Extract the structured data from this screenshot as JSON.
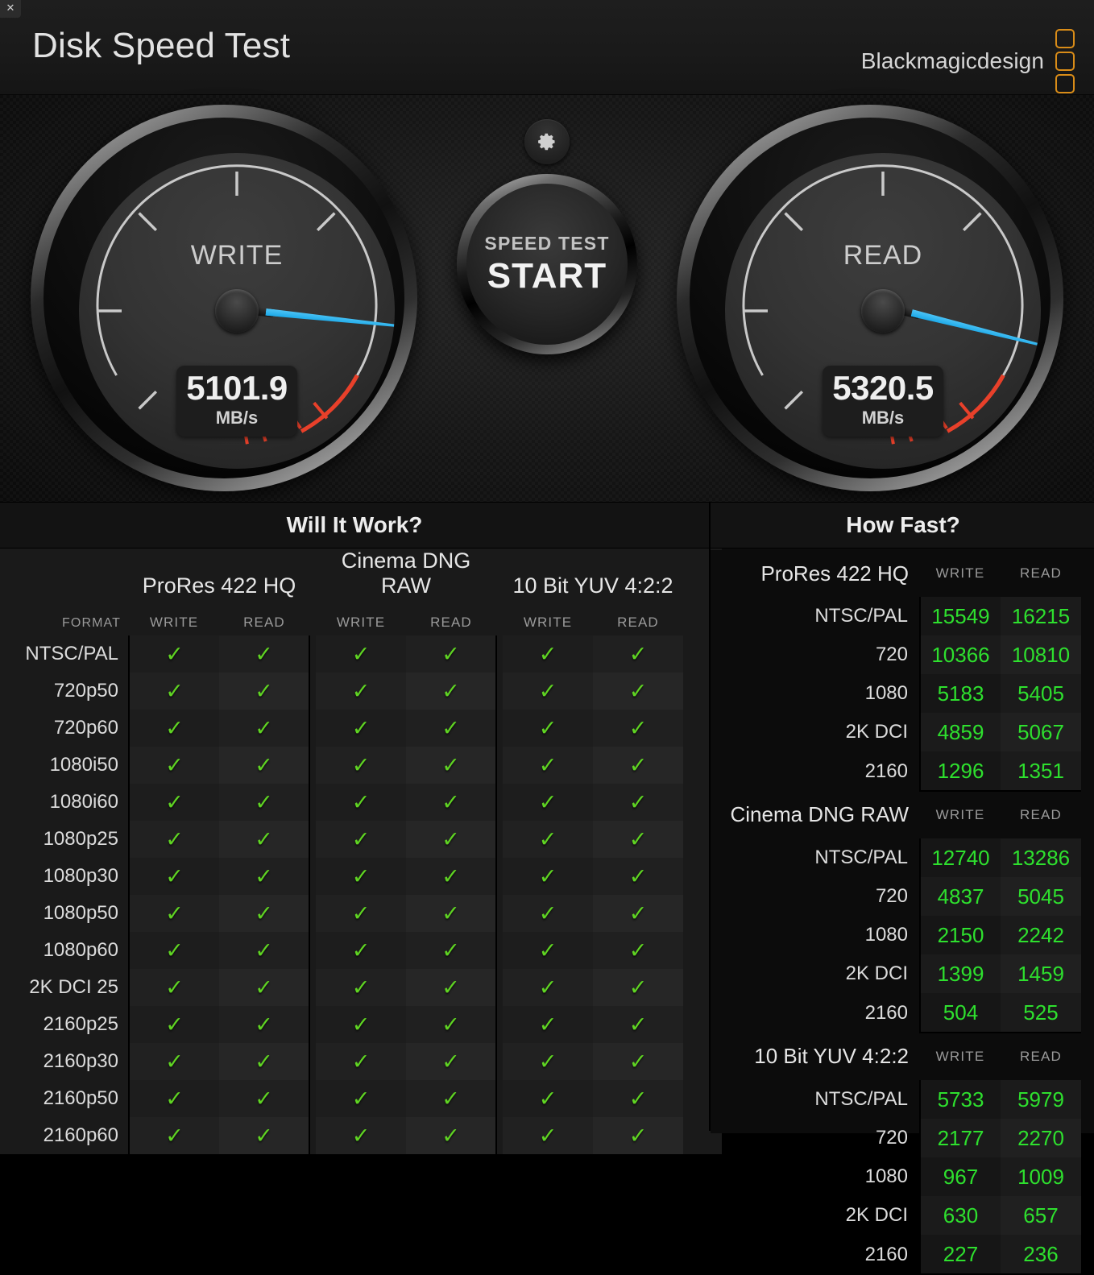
{
  "window": {
    "close_label": "✕"
  },
  "header": {
    "title": "Disk Speed Test",
    "brand": "Blackmagicdesign"
  },
  "gauges": {
    "write": {
      "label": "WRITE",
      "value": "5101.9",
      "unit": "MB/s"
    },
    "read": {
      "label": "READ",
      "value": "5320.5",
      "unit": "MB/s"
    }
  },
  "controls": {
    "gear_icon": "gear-icon",
    "start_line1": "SPEED TEST",
    "start_line2": "START"
  },
  "will_it_work": {
    "title": "Will It Work?",
    "format_header": "FORMAT",
    "groups": [
      "ProRes 422 HQ",
      "Cinema DNG RAW",
      "10 Bit YUV 4:2:2"
    ],
    "sub_headers": [
      "WRITE",
      "READ"
    ],
    "check_glyph": "✓",
    "rows": [
      {
        "format": "NTSC/PAL",
        "cells": [
          true,
          true,
          true,
          true,
          true,
          true
        ]
      },
      {
        "format": "720p50",
        "cells": [
          true,
          true,
          true,
          true,
          true,
          true
        ]
      },
      {
        "format": "720p60",
        "cells": [
          true,
          true,
          true,
          true,
          true,
          true
        ]
      },
      {
        "format": "1080i50",
        "cells": [
          true,
          true,
          true,
          true,
          true,
          true
        ]
      },
      {
        "format": "1080i60",
        "cells": [
          true,
          true,
          true,
          true,
          true,
          true
        ]
      },
      {
        "format": "1080p25",
        "cells": [
          true,
          true,
          true,
          true,
          true,
          true
        ]
      },
      {
        "format": "1080p30",
        "cells": [
          true,
          true,
          true,
          true,
          true,
          true
        ]
      },
      {
        "format": "1080p50",
        "cells": [
          true,
          true,
          true,
          true,
          true,
          true
        ]
      },
      {
        "format": "1080p60",
        "cells": [
          true,
          true,
          true,
          true,
          true,
          true
        ]
      },
      {
        "format": "2K DCI 25",
        "cells": [
          true,
          true,
          true,
          true,
          true,
          true
        ]
      },
      {
        "format": "2160p25",
        "cells": [
          true,
          true,
          true,
          true,
          true,
          true
        ]
      },
      {
        "format": "2160p30",
        "cells": [
          true,
          true,
          true,
          true,
          true,
          true
        ]
      },
      {
        "format": "2160p50",
        "cells": [
          true,
          true,
          true,
          true,
          true,
          true
        ]
      },
      {
        "format": "2160p60",
        "cells": [
          true,
          true,
          true,
          true,
          true,
          true
        ]
      }
    ]
  },
  "how_fast": {
    "title": "How Fast?",
    "sub_headers": [
      "WRITE",
      "READ"
    ],
    "sections": [
      {
        "name": "ProRes 422 HQ",
        "rows": [
          {
            "label": "NTSC/PAL",
            "write": "15549",
            "read": "16215"
          },
          {
            "label": "720",
            "write": "10366",
            "read": "10810"
          },
          {
            "label": "1080",
            "write": "5183",
            "read": "5405"
          },
          {
            "label": "2K DCI",
            "write": "4859",
            "read": "5067"
          },
          {
            "label": "2160",
            "write": "1296",
            "read": "1351"
          }
        ]
      },
      {
        "name": "Cinema DNG RAW",
        "rows": [
          {
            "label": "NTSC/PAL",
            "write": "12740",
            "read": "13286"
          },
          {
            "label": "720",
            "write": "4837",
            "read": "5045"
          },
          {
            "label": "1080",
            "write": "2150",
            "read": "2242"
          },
          {
            "label": "2K DCI",
            "write": "1399",
            "read": "1459"
          },
          {
            "label": "2160",
            "write": "504",
            "read": "525"
          }
        ]
      },
      {
        "name": "10 Bit YUV 4:2:2",
        "rows": [
          {
            "label": "NTSC/PAL",
            "write": "5733",
            "read": "5979"
          },
          {
            "label": "720",
            "write": "2177",
            "read": "2270"
          },
          {
            "label": "1080",
            "write": "967",
            "read": "1009"
          },
          {
            "label": "2K DCI",
            "write": "630",
            "read": "657"
          },
          {
            "label": "2160",
            "write": "227",
            "read": "236"
          }
        ]
      }
    ]
  },
  "colors": {
    "accent_orange": "#d98c18",
    "needle_blue": "#1aa8e8",
    "check_green": "#5fd422",
    "value_green": "#2ee02e",
    "redzone": "#e8402a"
  }
}
